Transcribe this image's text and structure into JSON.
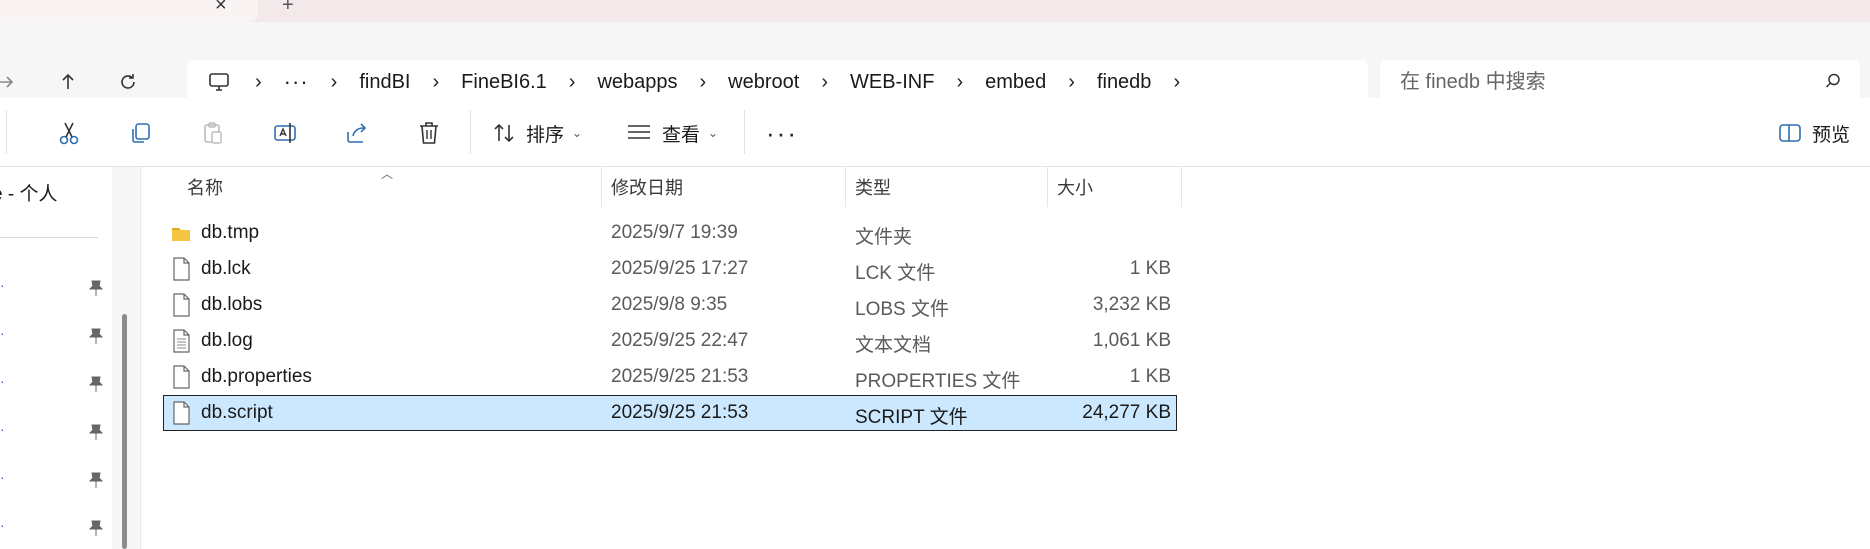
{
  "tab": {
    "close_glyph": "×",
    "new_glyph": "+"
  },
  "address": {
    "overflow": "···",
    "crumbs": [
      "findBI",
      "FineBI6.1",
      "webapps",
      "webroot",
      "WEB-INF",
      "embed",
      "finedb"
    ]
  },
  "search": {
    "placeholder": "在 finedb 中搜索"
  },
  "toolbar": {
    "sort_label": "排序",
    "view_label": "查看",
    "more_label": "···",
    "preview_label": "预览"
  },
  "sidebar": {
    "title": "e - 个人"
  },
  "columns": {
    "name": "名称",
    "date": "修改日期",
    "type": "类型",
    "size": "大小"
  },
  "files": [
    {
      "name": "db.tmp",
      "date": "2025/9/7 19:39",
      "type": "文件夹",
      "size": "",
      "icon": "folder-icon"
    },
    {
      "name": "db.lck",
      "date": "2025/9/25 17:27",
      "type": "LCK 文件",
      "size": "1 KB",
      "icon": "file-icon"
    },
    {
      "name": "db.lobs",
      "date": "2025/9/8 9:35",
      "type": "LOBS 文件",
      "size": "3,232 KB",
      "icon": "file-icon"
    },
    {
      "name": "db.log",
      "date": "2025/9/25 22:47",
      "type": "文本文档",
      "size": "1,061 KB",
      "icon": "text-file-icon"
    },
    {
      "name": "db.properties",
      "date": "2025/9/25 21:53",
      "type": "PROPERTIES 文件",
      "size": "1 KB",
      "icon": "file-icon"
    },
    {
      "name": "db.script",
      "date": "2025/9/25 21:53",
      "type": "SCRIPT 文件",
      "size": "24,277 KB",
      "icon": "file-icon",
      "selected": true
    }
  ],
  "colors": {
    "selection": "#cce8ff",
    "accent": "#2f6fb0",
    "folder": "#f5c542"
  }
}
